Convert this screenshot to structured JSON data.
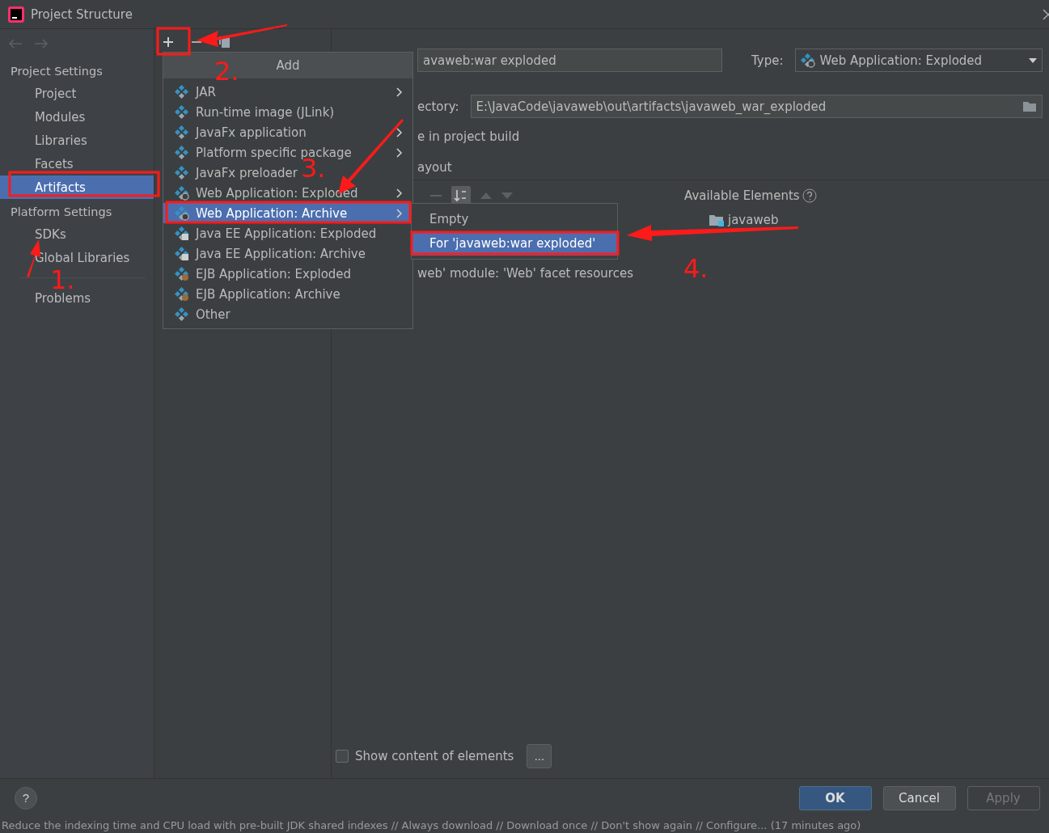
{
  "window": {
    "title": "Project Structure"
  },
  "sidebar": {
    "sections": [
      {
        "heading": "Project Settings",
        "items": [
          {
            "label": "Project",
            "selected": false
          },
          {
            "label": "Modules",
            "selected": false
          },
          {
            "label": "Libraries",
            "selected": false
          },
          {
            "label": "Facets",
            "selected": false
          },
          {
            "label": "Artifacts",
            "selected": true
          }
        ]
      },
      {
        "heading": "Platform Settings",
        "items": [
          {
            "label": "SDKs",
            "selected": false
          },
          {
            "label": "Global Libraries",
            "selected": false
          }
        ]
      },
      {
        "items": [
          {
            "label": "Problems",
            "selected": false
          }
        ]
      }
    ]
  },
  "add_menu": {
    "title": "Add",
    "items": [
      {
        "label": "JAR",
        "kind": "artifact",
        "has_submenu": true,
        "selected": false
      },
      {
        "label": "Run-time image (JLink)",
        "kind": "artifact",
        "has_submenu": false,
        "selected": false
      },
      {
        "label": "JavaFx application",
        "kind": "artifact",
        "has_submenu": true,
        "selected": false
      },
      {
        "label": "Platform specific package",
        "kind": "artifact",
        "has_submenu": true,
        "selected": false
      },
      {
        "label": "JavaFx preloader",
        "kind": "artifact",
        "has_submenu": false,
        "selected": false
      },
      {
        "label": "Web Application: Exploded",
        "kind": "web",
        "has_submenu": true,
        "selected": false
      },
      {
        "label": "Web Application: Archive",
        "kind": "web",
        "has_submenu": true,
        "selected": true
      },
      {
        "label": "Java EE Application: Exploded",
        "kind": "javaee",
        "has_submenu": false,
        "selected": false
      },
      {
        "label": "Java EE Application: Archive",
        "kind": "javaee",
        "has_submenu": false,
        "selected": false
      },
      {
        "label": "EJB Application: Exploded",
        "kind": "ejb",
        "has_submenu": false,
        "selected": false
      },
      {
        "label": "EJB Application: Archive",
        "kind": "ejb",
        "has_submenu": false,
        "selected": false
      },
      {
        "label": "Other",
        "kind": "artifact",
        "has_submenu": false,
        "selected": false
      }
    ]
  },
  "submenu": {
    "items": [
      {
        "label": "Empty",
        "selected": false
      },
      {
        "label": "For 'javaweb:war exploded'",
        "selected": true
      }
    ]
  },
  "artifact": {
    "name": "avaweb:war exploded",
    "type_label": "Type:",
    "type": "Web Application: Exploded",
    "output_label": "ectory:",
    "output_path": "E:\\JavaCode\\javaweb\\out\\artifacts\\javaweb_war_exploded",
    "include_label": "e in project build",
    "layout_tab": "ayout",
    "output_tree": [
      "web' module: 'Web' facet resources"
    ],
    "available_label": "Available Elements",
    "available_tree": [
      "javaweb"
    ]
  },
  "show_content": {
    "label": "Show content of elements",
    "checked": false
  },
  "more_button": "...",
  "help_button": "?",
  "buttons": [
    {
      "label": "OK",
      "kind": "primary",
      "disabled": false
    },
    {
      "label": "Cancel",
      "kind": "normal",
      "disabled": false
    },
    {
      "label": "Apply",
      "kind": "normal",
      "disabled": true
    }
  ],
  "annotations": [
    "1.",
    "2.",
    "3.",
    "4."
  ],
  "status_bar": {
    "text": "Reduce the indexing time and CPU load with pre-built JDK shared indexes // Always download // Download once // Don't show again // Configure... (17 minutes ago)"
  }
}
